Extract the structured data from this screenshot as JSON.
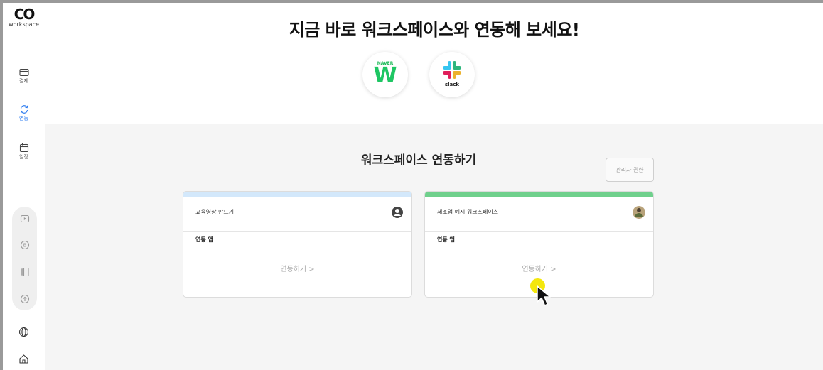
{
  "logo": {
    "mark": "CO",
    "text": "workspace"
  },
  "sidebar": {
    "items": [
      {
        "label": "결제",
        "icon": "card-icon"
      },
      {
        "label": "연동",
        "icon": "sync-icon"
      },
      {
        "label": "일정",
        "icon": "calendar-icon"
      }
    ],
    "tools": [
      "play-icon",
      "b-coin-icon",
      "notebook-icon",
      "upload-icon"
    ],
    "bottom": [
      "globe-icon",
      "home-icon"
    ]
  },
  "header": {
    "headline": "지금 바로 워크스페이스와 연동해 보세요!",
    "apps": [
      {
        "name": "NAVER",
        "glyph": "W",
        "icon": "naver-works-icon"
      },
      {
        "name": "slack",
        "icon": "slack-icon"
      }
    ]
  },
  "main": {
    "title": "워크스페이스 연동하기",
    "admin_button": "관리자 권한",
    "cards": [
      {
        "name": "교육영상 만드기",
        "sub": "연동 앱",
        "link": "연동하기 >",
        "bar_color": "#d3e8fb"
      },
      {
        "name": "제조업 예시 워크스페이스",
        "sub": "연동 앱",
        "link": "연동하기 >",
        "bar_color": "#6fd08c"
      }
    ]
  }
}
